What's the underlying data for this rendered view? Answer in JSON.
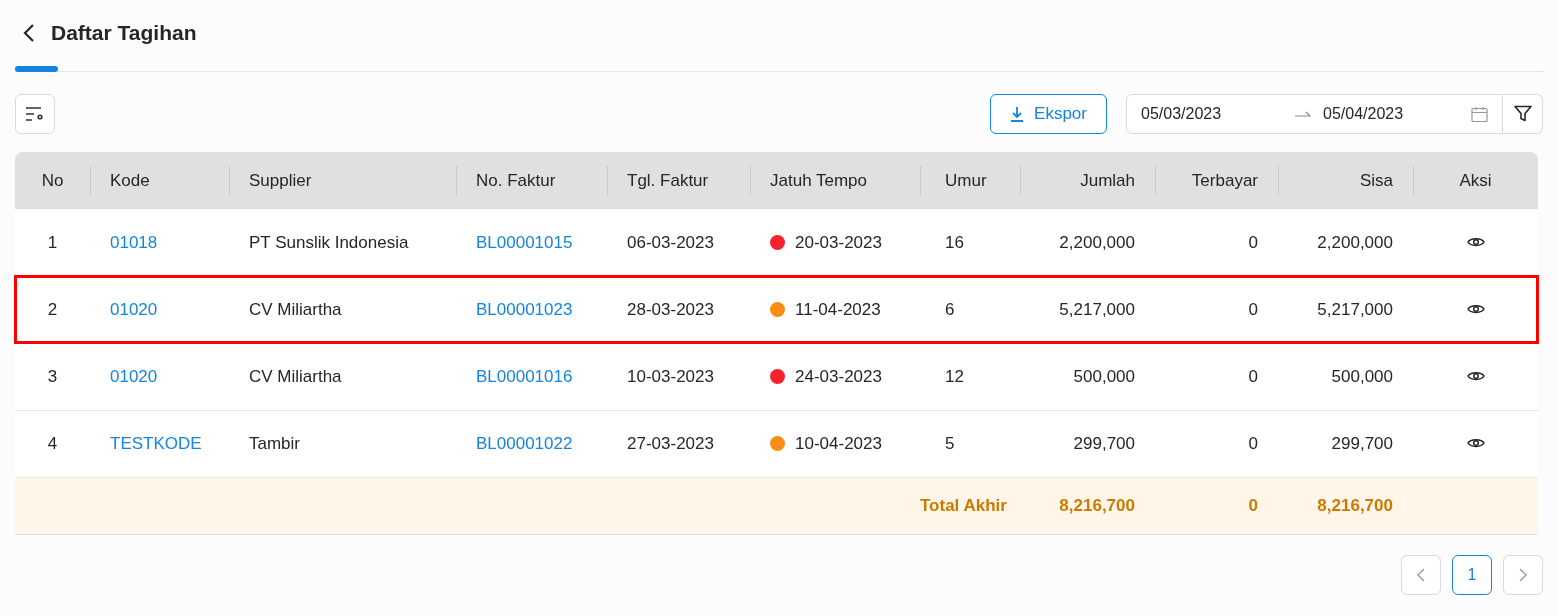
{
  "page": {
    "title": "Daftar Tagihan"
  },
  "toolbar": {
    "export_button": "Ekspor",
    "date_from": "05/03/2023",
    "date_to": "05/04/2023"
  },
  "table": {
    "columns": [
      "No",
      "Kode",
      "Supplier",
      "No. Faktur",
      "Tgl. Faktur",
      "Jatuh Tempo",
      "Umur",
      "Jumlah",
      "Terbayar",
      "Sisa",
      "Aksi"
    ],
    "rows": [
      {
        "no": "1",
        "kode": "01018",
        "supplier": "PT Sunslik Indonesia",
        "faktur": "BL00001015",
        "tgl": "06-03-2023",
        "jatuh_tempo": "20-03-2023",
        "color": "#f5222d",
        "umur": "16",
        "jumlah": "2,200,000",
        "terbayar": "0",
        "sisa": "2,200,000",
        "highlighted": false
      },
      {
        "no": "2",
        "kode": "01020",
        "supplier": "CV Miliartha",
        "faktur": "BL00001023",
        "tgl": "28-03-2023",
        "jatuh_tempo": "11-04-2023",
        "color": "#fa8c16",
        "umur": "6",
        "jumlah": "5,217,000",
        "terbayar": "0",
        "sisa": "5,217,000",
        "highlighted": true
      },
      {
        "no": "3",
        "kode": "01020",
        "supplier": "CV Miliartha",
        "faktur": "BL00001016",
        "tgl": "10-03-2023",
        "jatuh_tempo": "24-03-2023",
        "color": "#f5222d",
        "umur": "12",
        "jumlah": "500,000",
        "terbayar": "0",
        "sisa": "500,000",
        "highlighted": false
      },
      {
        "no": "4",
        "kode": "TESTKODE",
        "supplier": "Tambir",
        "faktur": "BL00001022",
        "tgl": "27-03-2023",
        "jatuh_tempo": "10-04-2023",
        "color": "#fa8c16",
        "umur": "5",
        "jumlah": "299,700",
        "terbayar": "0",
        "sisa": "299,700",
        "highlighted": false
      }
    ],
    "total": {
      "label": "Total Akhir",
      "jumlah": "8,216,700",
      "terbayar": "0",
      "sisa": "8,216,700"
    }
  },
  "pagination": {
    "pages": [
      {
        "label": "1",
        "selected": true
      }
    ]
  }
}
